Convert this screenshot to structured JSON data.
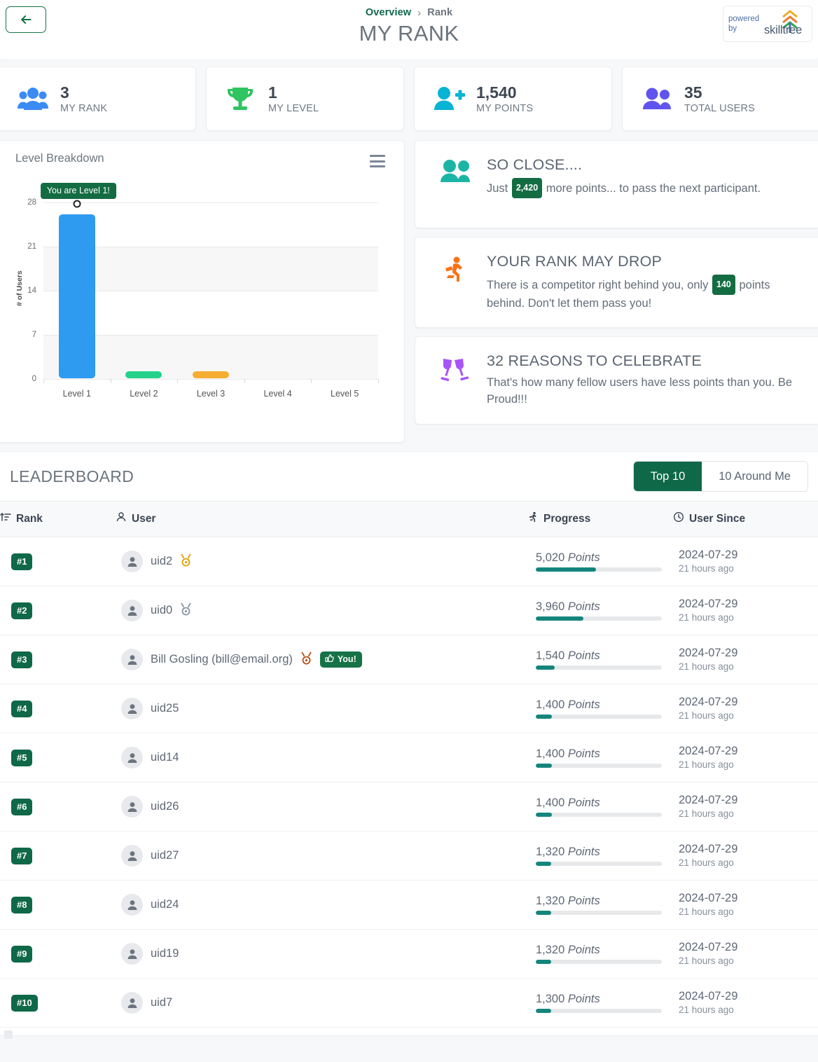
{
  "header": {
    "back_label": "back-arrow",
    "breadcrumb": {
      "parent": "Overview",
      "separator": "›",
      "current": "Rank"
    },
    "title": "MY RANK",
    "powered_by": {
      "line1": "powered",
      "line2": "by",
      "brand": "skilltree"
    }
  },
  "stats": [
    {
      "value": "3",
      "label": "MY RANK",
      "icon": "users-group-icon",
      "color": "#3b8bf4"
    },
    {
      "value": "1",
      "label": "MY LEVEL",
      "icon": "trophy-icon",
      "color": "#2ec45f"
    },
    {
      "value": "1,540",
      "label": "MY POINTS",
      "icon": "user-plus-icon",
      "color": "#08b4d3"
    },
    {
      "value": "35",
      "label": "TOTAL USERS",
      "icon": "users-pair-icon",
      "color": "#6054ef"
    }
  ],
  "chart_data": {
    "type": "bar",
    "title": "Level Breakdown",
    "xlabel": "",
    "ylabel": "# of Users",
    "categories": [
      "Level 1",
      "Level 2",
      "Level 3",
      "Level 4",
      "Level 5"
    ],
    "values": [
      26,
      1,
      1,
      0,
      0
    ],
    "colors": [
      "#2e9bf0",
      "#23d18b",
      "#f5ad32",
      "#2e9bf0",
      "#2e9bf0"
    ],
    "yticks": [
      0,
      7,
      14,
      21,
      28
    ],
    "ylim": [
      0,
      28
    ],
    "grid": true,
    "legend": "none",
    "annotation": {
      "text": "You are Level 1!",
      "category": "Level 1",
      "value": 28
    },
    "menu_icon": "hamburger-menu-icon"
  },
  "insights": [
    {
      "icon": "users-pair-icon",
      "icon_color": "#1bb5a5",
      "title": "SO CLOSE....",
      "text_before": "Just",
      "pill": "2,420",
      "text_after": "more points... to pass the next participant."
    },
    {
      "icon": "running-person-icon",
      "icon_color": "#f97316",
      "title": "YOUR RANK MAY DROP",
      "text_before": "There is a competitor right behind you, only",
      "pill": "140",
      "text_after": "points behind. Don't let them pass you!"
    },
    {
      "icon": "champagne-glasses-icon",
      "icon_color": "#a855f7",
      "title": "32 REASONS TO CELEBRATE",
      "text_before": "That's how many fellow users have less points than you. Be Proud!!!",
      "pill": "",
      "text_after": ""
    }
  ],
  "leaderboard": {
    "title": "LEADERBOARD",
    "toggle": {
      "options": [
        "Top 10",
        "10 Around Me"
      ],
      "selected": "Top 10"
    },
    "columns": [
      {
        "label": "Rank",
        "icon": "sort-ascending-icon"
      },
      {
        "label": "User",
        "icon": "user-icon"
      },
      {
        "label": "Progress",
        "icon": "running-person-icon"
      },
      {
        "label": "User Since",
        "icon": "clock-icon"
      }
    ],
    "points_unit": "Points",
    "you_badge": "You!",
    "rows": [
      {
        "rank": "#1",
        "user": "uid2",
        "medal": "gold",
        "is_you": false,
        "points": "5,020",
        "progress_pct": 48,
        "since_date": "2024-07-29",
        "since_ago": "21 hours ago"
      },
      {
        "rank": "#2",
        "user": "uid0",
        "medal": "silver",
        "is_you": false,
        "points": "3,960",
        "progress_pct": 38,
        "since_date": "2024-07-29",
        "since_ago": "21 hours ago"
      },
      {
        "rank": "#3",
        "user": "Bill Gosling (bill@email.org)",
        "medal": "bronze",
        "is_you": true,
        "points": "1,540",
        "progress_pct": 15,
        "since_date": "2024-07-29",
        "since_ago": "21 hours ago"
      },
      {
        "rank": "#4",
        "user": "uid25",
        "medal": "",
        "is_you": false,
        "points": "1,400",
        "progress_pct": 13,
        "since_date": "2024-07-29",
        "since_ago": "21 hours ago"
      },
      {
        "rank": "#5",
        "user": "uid14",
        "medal": "",
        "is_you": false,
        "points": "1,400",
        "progress_pct": 13,
        "since_date": "2024-07-29",
        "since_ago": "21 hours ago"
      },
      {
        "rank": "#6",
        "user": "uid26",
        "medal": "",
        "is_you": false,
        "points": "1,400",
        "progress_pct": 13,
        "since_date": "2024-07-29",
        "since_ago": "21 hours ago"
      },
      {
        "rank": "#7",
        "user": "uid27",
        "medal": "",
        "is_you": false,
        "points": "1,320",
        "progress_pct": 12,
        "since_date": "2024-07-29",
        "since_ago": "21 hours ago"
      },
      {
        "rank": "#8",
        "user": "uid24",
        "medal": "",
        "is_you": false,
        "points": "1,320",
        "progress_pct": 12,
        "since_date": "2024-07-29",
        "since_ago": "21 hours ago"
      },
      {
        "rank": "#9",
        "user": "uid19",
        "medal": "",
        "is_you": false,
        "points": "1,320",
        "progress_pct": 12,
        "since_date": "2024-07-29",
        "since_ago": "21 hours ago"
      },
      {
        "rank": "#10",
        "user": "uid7",
        "medal": "",
        "is_you": false,
        "points": "1,300",
        "progress_pct": 12,
        "since_date": "2024-07-29",
        "since_ago": "21 hours ago"
      }
    ]
  },
  "theme": {
    "accent_green": "#0f6848",
    "progress_teal": "#14857c",
    "text_muted": "#6c757d",
    "page_bg": "#f7f8fa"
  }
}
